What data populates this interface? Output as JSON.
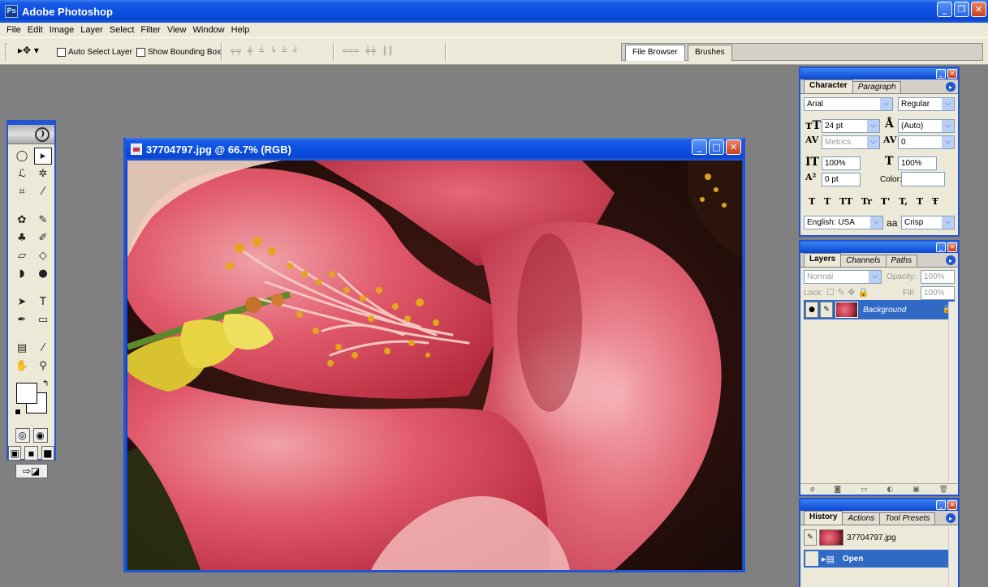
{
  "app": {
    "title": "Adobe Photoshop",
    "logo": "Ps"
  },
  "menu": [
    "File",
    "Edit",
    "Image",
    "Layer",
    "Select",
    "Filter",
    "View",
    "Window",
    "Help"
  ],
  "options": {
    "tool_icon": "move-tool-icon",
    "auto_select": "Auto Select Layer",
    "bounding_box": "Show Bounding Box"
  },
  "well": {
    "tabs": [
      "File Browser",
      "Brushes"
    ]
  },
  "document": {
    "title": "37704797.jpg @ 66.7% (RGB)"
  },
  "character": {
    "tabs": [
      "Character",
      "Paragraph"
    ],
    "font": "Arial",
    "style": "Regular",
    "size": "24 pt",
    "leading": "(Auto)",
    "kerning": "Metrics",
    "tracking": "0",
    "vscale": "100%",
    "hscale": "100%",
    "baseline": "0 pt",
    "color_label": "Color:",
    "styles_row": "T T TT Tr T' T, T Ŧ",
    "language": "English: USA",
    "aa_label": "a",
    "antialias": "Crisp"
  },
  "layers": {
    "tabs": [
      "Layers",
      "Channels",
      "Paths"
    ],
    "blend": "Normal",
    "opacity_label": "Opacity:",
    "opacity": "100%",
    "lock_label": "Lock:",
    "fill_label": "Fill:",
    "fill": "100%",
    "layer_name": "Background"
  },
  "history": {
    "tabs": [
      "History",
      "Actions",
      "Tool Presets"
    ],
    "snapshot": "37704797.jpg",
    "step": "Open"
  },
  "colors": {
    "accent": "#1f56d6",
    "selection": "#316ac5",
    "chrome": "#ece9d8"
  }
}
